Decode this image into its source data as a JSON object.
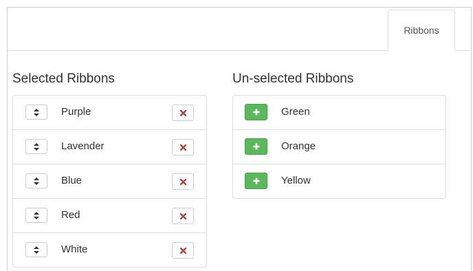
{
  "tabs": [
    {
      "label": "Ribbons",
      "active": true
    }
  ],
  "selected": {
    "title": "Selected Ribbons",
    "items": [
      {
        "label": "Purple"
      },
      {
        "label": "Lavender"
      },
      {
        "label": "Blue"
      },
      {
        "label": "Red"
      },
      {
        "label": "White"
      }
    ]
  },
  "unselected": {
    "title": "Un-selected Ribbons",
    "items": [
      {
        "label": "Green"
      },
      {
        "label": "Orange"
      },
      {
        "label": "Yellow"
      }
    ]
  },
  "colors": {
    "remove_icon": "#a94442",
    "add_button": "#5cb85c",
    "border": "#dddddd"
  },
  "icons": {
    "sort": "sort-icon",
    "remove": "remove-icon",
    "add": "plus-icon"
  }
}
